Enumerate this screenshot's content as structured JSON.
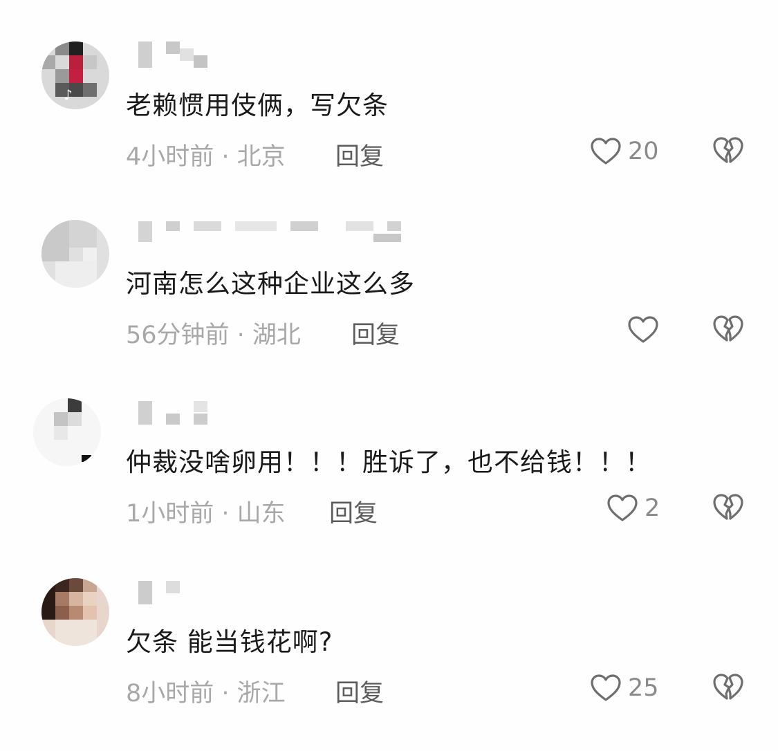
{
  "icons": {
    "like": "heart-outline-icon",
    "dislike": "broken-heart-icon",
    "reply": "reply-link"
  },
  "colors": {
    "text": "#1a1a1a",
    "meta": "#a8a8a8",
    "reply": "#5c5c5c",
    "icon": "#6e6e6e"
  },
  "comments": [
    {
      "text": "老赖惯用伎俩，写欠条",
      "time": "4小时前",
      "location": "北京",
      "meta": "4小时前 · 北京",
      "reply": "回复",
      "likes": "20"
    },
    {
      "text": "河南怎么这种企业这么多",
      "time": "56分钟前",
      "location": "湖北",
      "meta": "56分钟前 · 湖北",
      "reply": "回复",
      "likes": ""
    },
    {
      "text": "仲裁没啥卵用！！！胜诉了，也不给钱！！！",
      "time": "1小时前",
      "location": "山东",
      "meta": "1小时前 · 山东",
      "reply": "回复",
      "likes": "2"
    },
    {
      "text": "欠条 能当钱花啊?",
      "time": "8小时前",
      "location": "浙江",
      "meta": "8小时前 · 浙江",
      "reply": "回复",
      "likes": "25"
    }
  ]
}
